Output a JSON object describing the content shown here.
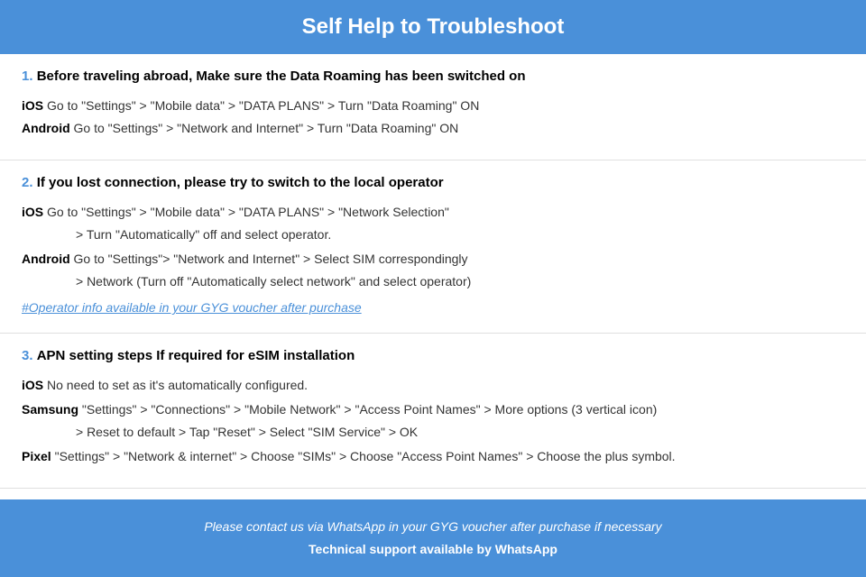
{
  "header": {
    "title": "Self Help to Troubleshoot"
  },
  "sections": [
    {
      "number": "1.",
      "title": "Before traveling abroad, Make sure the Data Roaming has been switched on",
      "items": [
        {
          "platform": "iOS",
          "text": "   Go to \"Settings\" > \"Mobile data\" > \"DATA PLANS\" > Turn \"Data Roaming\" ON",
          "continuation": null
        },
        {
          "platform": "Android",
          "text": "    Go to \"Settings\" > \"Network and Internet\" > Turn \"Data Roaming\" ON",
          "continuation": null
        }
      ],
      "voucher_link": null
    },
    {
      "number": "2.",
      "title": "If you lost connection, please try to switch to the local operator",
      "items": [
        {
          "platform": "iOS",
          "text": "     Go to \"Settings\" > \"Mobile data\" > \"DATA PLANS\" > \"Network Selection\"",
          "continuation": "> Turn \"Automatically\" off and select operator."
        },
        {
          "platform": "Android",
          "text": "    Go to \"Settings\">  \"Network and Internet\" > Select SIM correspondingly",
          "continuation": "> Network (Turn off \"Automatically select network\" and select operator)"
        }
      ],
      "voucher_link": "#Operator info available in your GYG voucher after purchase"
    },
    {
      "number": "3.",
      "title": "APN setting steps If required for eSIM installation",
      "items": [
        {
          "platform": "iOS",
          "text": "    No need to set as it's automatically configured.",
          "continuation": null
        },
        {
          "platform": "Samsung",
          "text": "    \"Settings\" > \"Connections\" > \"Mobile Network\" > \"Access Point Names\" > More options (3 vertical icon)",
          "continuation": "> Reset to default > Tap \"Reset\" > Select \"SIM Service\" > OK"
        },
        {
          "platform": "Pixel",
          "text": "    \"Settings\" > \"Network & internet\" > Choose \"SIMs\" > Choose \"Access Point Names\" > Choose the plus symbol.",
          "continuation": null
        }
      ],
      "voucher_link": null
    }
  ],
  "footer": {
    "line1": "Please contact us via WhatsApp  in your GYG voucher after purchase if necessary",
    "line2": "Technical support available by WhatsApp"
  }
}
